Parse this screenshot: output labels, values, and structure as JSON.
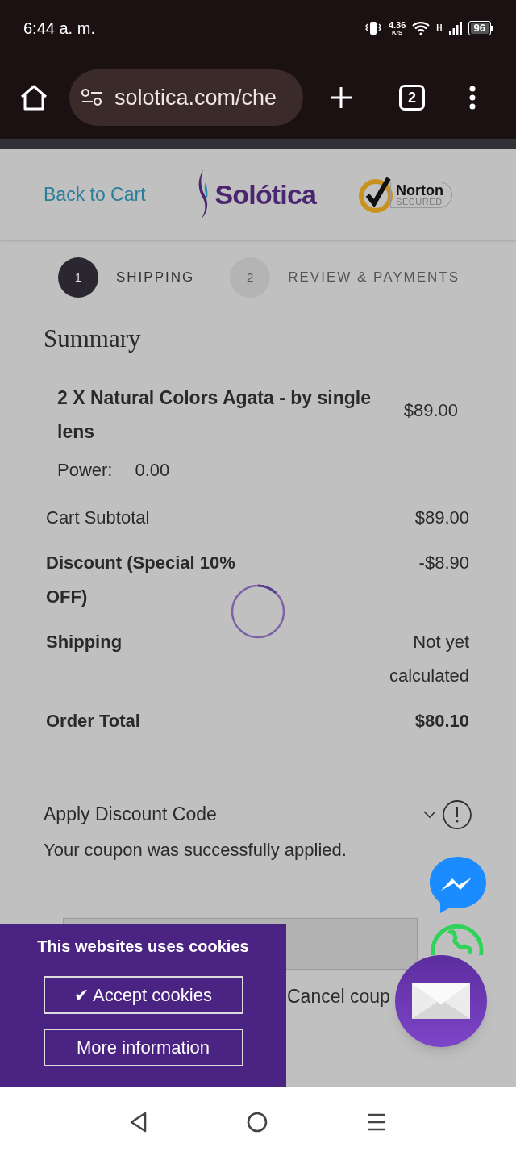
{
  "status_bar": {
    "time": "6:44 a. m.",
    "network_speed": "4.36",
    "network_unit": "K/S",
    "network_type": "H",
    "battery": "96"
  },
  "browser": {
    "url": "solotica.com/che",
    "tab_count": "2"
  },
  "header": {
    "back_link": "Back to Cart",
    "logo": "Solótica",
    "badge": {
      "title": "Norton",
      "subtitle": "SECURED"
    }
  },
  "steps": [
    {
      "number": "1",
      "label": "SHIPPING",
      "selected": true
    },
    {
      "number": "2",
      "label": "REVIEW & PAYMENTS",
      "selected": false
    }
  ],
  "summary": {
    "title": "Summary",
    "items": [
      {
        "name": "2 X Natural Colors Agata - by single lens",
        "price": "$89.00",
        "option_label": "Power:",
        "option_value": "0.00"
      }
    ],
    "totals": [
      {
        "label": "Cart Subtotal",
        "value": "$89.00",
        "kind": "plain"
      },
      {
        "label": "Discount (Special 10% OFF)",
        "value": "-$8.90",
        "kind": "label-bold"
      },
      {
        "label": "Shipping",
        "value": "Not yet calculated",
        "kind": "label-bold"
      },
      {
        "label": "Order Total",
        "value": "$80.10",
        "kind": "total"
      }
    ],
    "discount": {
      "title": "Apply Discount Code",
      "expanded": false,
      "message": "Your coupon was successfully applied.",
      "cancel_link": "Cancel coup"
    }
  },
  "cookie_banner": {
    "title": "This websites uses cookies",
    "buttons": [
      {
        "label": "✔ Accept cookies"
      },
      {
        "label": "More information"
      }
    ]
  }
}
